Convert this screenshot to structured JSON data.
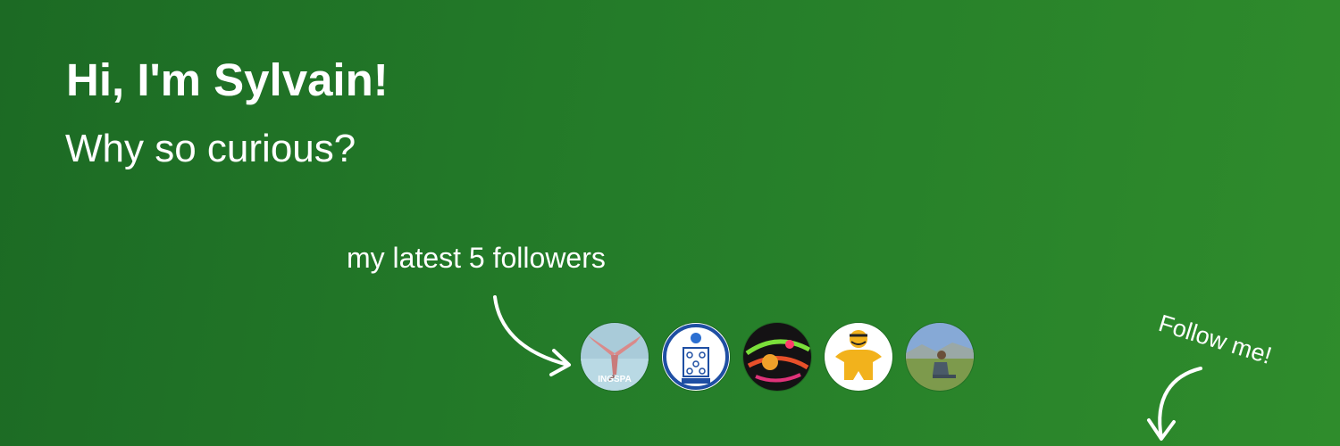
{
  "header": {
    "title": "Hi, I'm Sylvain!",
    "subtitle": "Why so curious?"
  },
  "followers": {
    "label": "my latest 5 followers",
    "avatars": [
      {
        "icon": "wingspan-avatar-icon",
        "text": "INGSPA"
      },
      {
        "icon": "robot-board-avatar-icon"
      },
      {
        "icon": "neon-space-avatar-icon"
      },
      {
        "icon": "meeple-avatar-icon"
      },
      {
        "icon": "person-outdoors-avatar-icon"
      }
    ]
  },
  "cta": {
    "label": "Follow me!"
  },
  "colors": {
    "background_start": "#1c6a24",
    "background_end": "#2f8c2c",
    "text": "#ffffff"
  }
}
